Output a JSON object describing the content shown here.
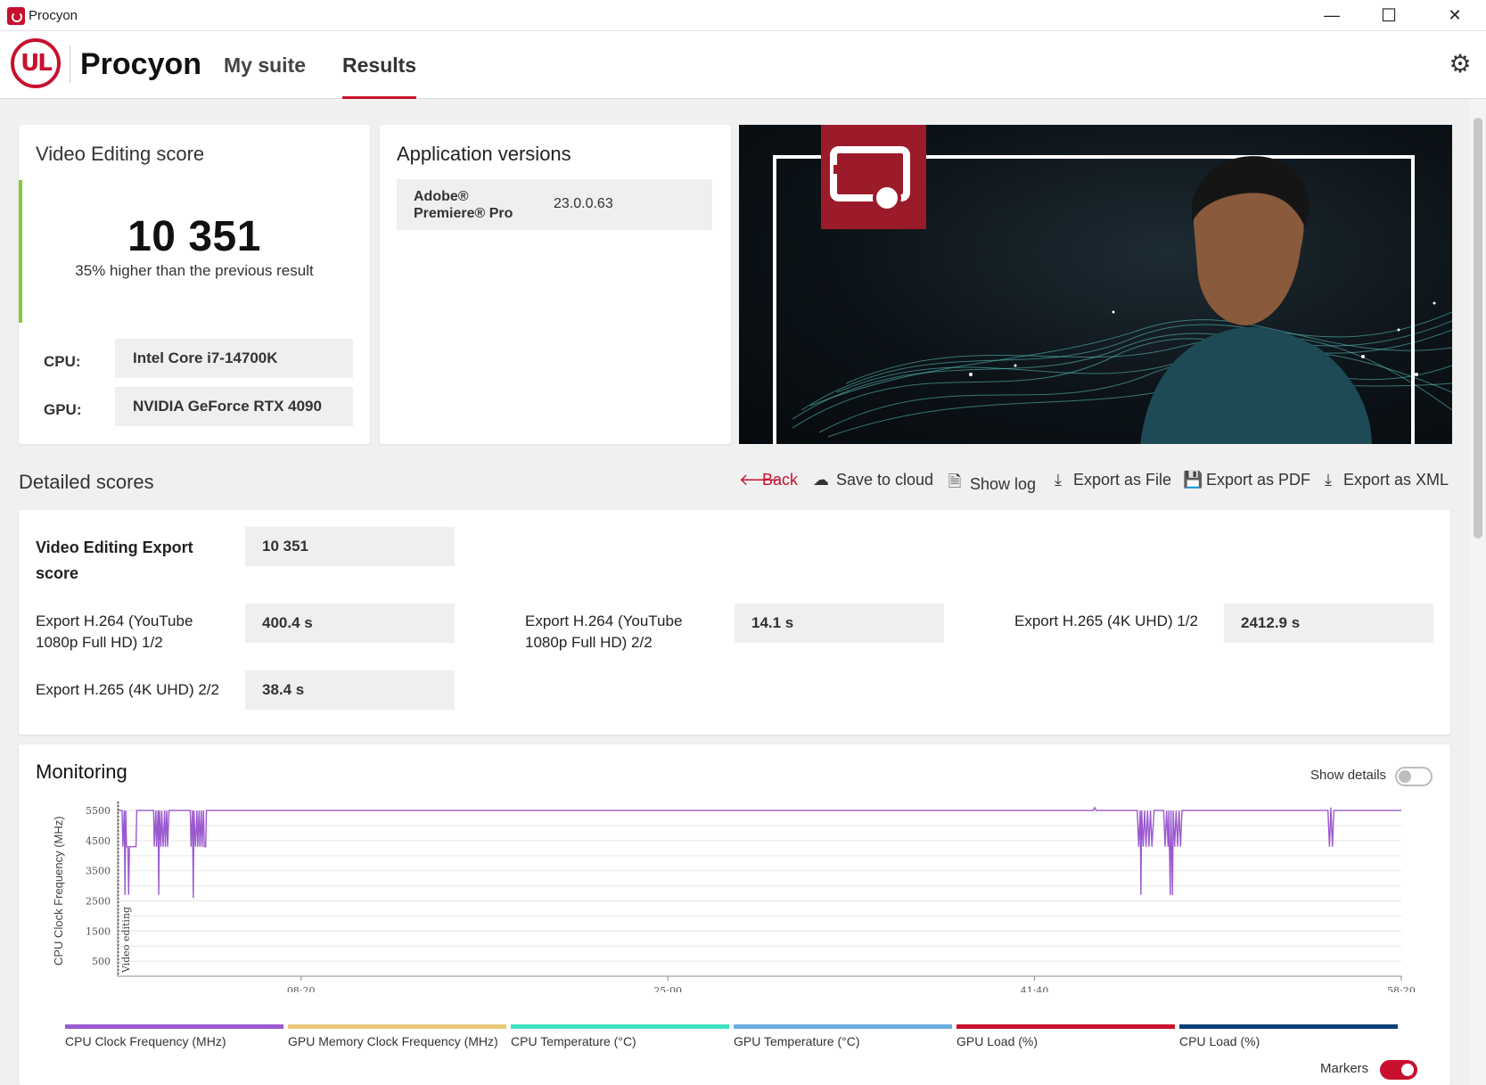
{
  "window": {
    "title": "Procyon",
    "minimize": "—",
    "maximize": "☐",
    "close": "✕"
  },
  "header": {
    "logo_text": "UL",
    "brand": "Procyon",
    "tabs": [
      {
        "label": "My suite"
      },
      {
        "label": "Results"
      }
    ],
    "active_tab": "Results"
  },
  "score_card": {
    "title": "Video Editing score",
    "score": "10 351",
    "comparison": "35% higher than the previous result",
    "cpu_label": "CPU:",
    "cpu_value": "Intel Core i7-14700K",
    "gpu_label": "GPU:",
    "gpu_value": "NVIDIA GeForce RTX 4090"
  },
  "app_versions": {
    "title": "Application versions",
    "items": [
      {
        "name": "Adobe® Premiere® Pro",
        "version": "23.0.0.63"
      }
    ]
  },
  "detailed": {
    "title": "Detailed scores",
    "actions": {
      "back": "Back",
      "save_cloud": "Save to cloud",
      "show_log": "Show log",
      "export_file": "Export as File",
      "export_pdf": "Export as PDF",
      "export_xml": "Export as XML"
    },
    "export_score_label": "Video Editing Export score",
    "export_score_value": "10 351",
    "rows": [
      {
        "label": "Export H.264 (YouTube 1080p Full HD) 1/2",
        "value": "400.4 s"
      },
      {
        "label": "Export H.264 (YouTube 1080p Full HD) 2/2",
        "value": "14.1 s"
      },
      {
        "label": "Export H.265 (4K UHD) 1/2",
        "value": "2412.9 s"
      },
      {
        "label": "Export H.265 (4K UHD) 2/2",
        "value": "38.4 s"
      }
    ]
  },
  "monitoring": {
    "title": "Monitoring",
    "show_details_label": "Show details",
    "show_details_on": false,
    "markers_label": "Markers",
    "markers_on": true,
    "legend": [
      {
        "name": "CPU Clock Frequency (MHz)",
        "color": "#9b59d0"
      },
      {
        "name": "GPU Memory Clock Frequency (MHz)",
        "color": "#e8c97a"
      },
      {
        "name": "CPU Temperature (°C)",
        "color": "#3ee0c0"
      },
      {
        "name": "GPU Temperature (°C)",
        "color": "#6aaee0"
      },
      {
        "name": "GPU Load (%)",
        "color": "#c8102e"
      },
      {
        "name": "CPU Load (%)",
        "color": "#0d3f7a"
      }
    ]
  },
  "chart_data": {
    "type": "line",
    "title": "",
    "xlabel": "",
    "ylabel": "CPU Clock Frequency (MHz)",
    "ylim": [
      0,
      5800
    ],
    "xlim": [
      0,
      3500
    ],
    "yticks": [
      500,
      1500,
      2500,
      3500,
      4500,
      5500
    ],
    "xticks": [
      {
        "v": 500,
        "label": "08:20"
      },
      {
        "v": 1500,
        "label": "25:00"
      },
      {
        "v": 2500,
        "label": "41:40"
      },
      {
        "v": 3500,
        "label": "58:20"
      }
    ],
    "marker": {
      "x": 2,
      "label": "Video editing"
    },
    "grid": true,
    "series": [
      {
        "name": "CPU Clock Frequency (MHz)",
        "color": "#9b59d0",
        "points": [
          [
            2,
            5500
          ],
          [
            12,
            5500
          ],
          [
            14,
            4300
          ],
          [
            18,
            5500
          ],
          [
            20,
            2700
          ],
          [
            22,
            5500
          ],
          [
            24,
            4300
          ],
          [
            28,
            4300
          ],
          [
            30,
            2700
          ],
          [
            32,
            4300
          ],
          [
            36,
            4300
          ],
          [
            40,
            4300
          ],
          [
            42,
            4300
          ],
          [
            44,
            4300
          ],
          [
            48,
            4300
          ],
          [
            50,
            4300
          ],
          [
            52,
            5500
          ],
          [
            56,
            5500
          ],
          [
            98,
            5500
          ],
          [
            100,
            4300
          ],
          [
            104,
            5500
          ],
          [
            106,
            4300
          ],
          [
            110,
            5500
          ],
          [
            112,
            2700
          ],
          [
            114,
            5500
          ],
          [
            118,
            4300
          ],
          [
            120,
            5500
          ],
          [
            124,
            4300
          ],
          [
            128,
            5500
          ],
          [
            130,
            4300
          ],
          [
            134,
            5500
          ],
          [
            136,
            4300
          ],
          [
            140,
            5500
          ],
          [
            144,
            5500
          ],
          [
            198,
            5500
          ],
          [
            200,
            4300
          ],
          [
            204,
            5500
          ],
          [
            206,
            2600
          ],
          [
            208,
            5500
          ],
          [
            212,
            4300
          ],
          [
            216,
            5500
          ],
          [
            218,
            4300
          ],
          [
            222,
            5500
          ],
          [
            224,
            4300
          ],
          [
            228,
            5500
          ],
          [
            230,
            4300
          ],
          [
            234,
            5500
          ],
          [
            236,
            4300
          ],
          [
            240,
            4300
          ],
          [
            242,
            5500
          ],
          [
            2630,
            5500
          ],
          [
            2660,
            5500
          ],
          [
            2664,
            5600
          ],
          [
            2668,
            5500
          ],
          [
            2780,
            5500
          ],
          [
            2784,
            4300
          ],
          [
            2788,
            5500
          ],
          [
            2790,
            2700
          ],
          [
            2792,
            5500
          ],
          [
            2796,
            4300
          ],
          [
            2800,
            5500
          ],
          [
            2804,
            4300
          ],
          [
            2808,
            5500
          ],
          [
            2812,
            4300
          ],
          [
            2816,
            5500
          ],
          [
            2820,
            4300
          ],
          [
            2826,
            5500
          ],
          [
            2852,
            5500
          ],
          [
            2856,
            4300
          ],
          [
            2860,
            5500
          ],
          [
            2864,
            4300
          ],
          [
            2866,
            5500
          ],
          [
            2870,
            2700
          ],
          [
            2872,
            5500
          ],
          [
            2876,
            2700
          ],
          [
            2878,
            5500
          ],
          [
            2882,
            4300
          ],
          [
            2886,
            5500
          ],
          [
            2890,
            4300
          ],
          [
            2894,
            5500
          ],
          [
            2898,
            4300
          ],
          [
            2902,
            5500
          ],
          [
            3300,
            5500
          ],
          [
            3304,
            4300
          ],
          [
            3308,
            5600
          ],
          [
            3312,
            4300
          ],
          [
            3316,
            5500
          ],
          [
            3500,
            5500
          ]
        ]
      }
    ]
  }
}
